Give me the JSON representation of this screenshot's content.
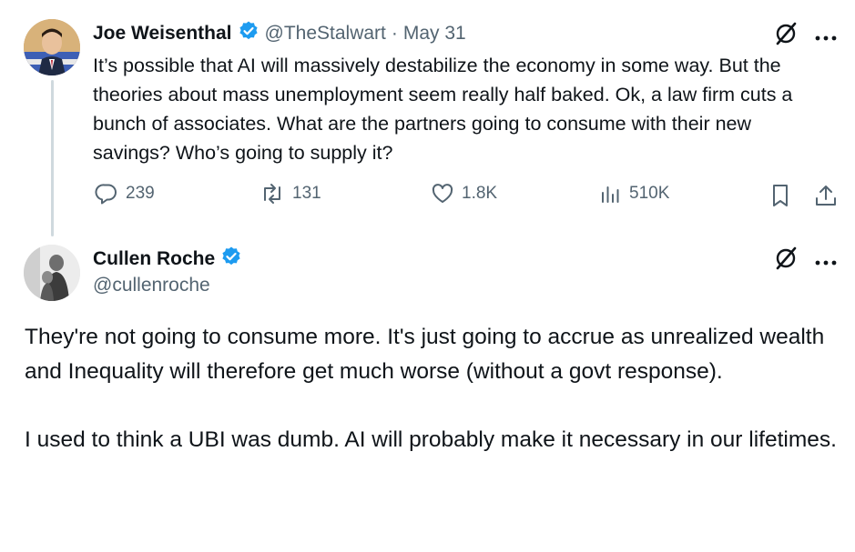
{
  "colors": {
    "text": "#0f1419",
    "muted": "#536471",
    "verified": "#1d9bf0",
    "thread": "#cfd9de"
  },
  "tweet1": {
    "author": "Joe Weisenthal",
    "handle": "@TheStalwart",
    "separator": "·",
    "date": "May 31",
    "text": "It’s possible that AI will massively destabilize the economy in some way. But the theories about mass unemployment seem really half baked. Ok, a law firm cuts a bunch of associates. What are the partners going to consume with their new savings? Who’s going to supply it?",
    "metrics": {
      "replies": "239",
      "reposts": "131",
      "likes": "1.8K",
      "views": "510K"
    },
    "icons": [
      "grok-icon",
      "more-icon",
      "reply-icon",
      "repost-icon",
      "like-icon",
      "views-icon",
      "bookmark-icon",
      "share-icon"
    ]
  },
  "tweet2": {
    "author": "Cullen Roche",
    "handle": "@cullenroche",
    "paragraph1": "They're not going to consume more. It's just going to accrue as unrealized wealth and Inequality will therefore get much worse (without a govt response).",
    "paragraph2": "I used to think a UBI was dumb. AI will probably make it necessary in our lifetimes."
  }
}
